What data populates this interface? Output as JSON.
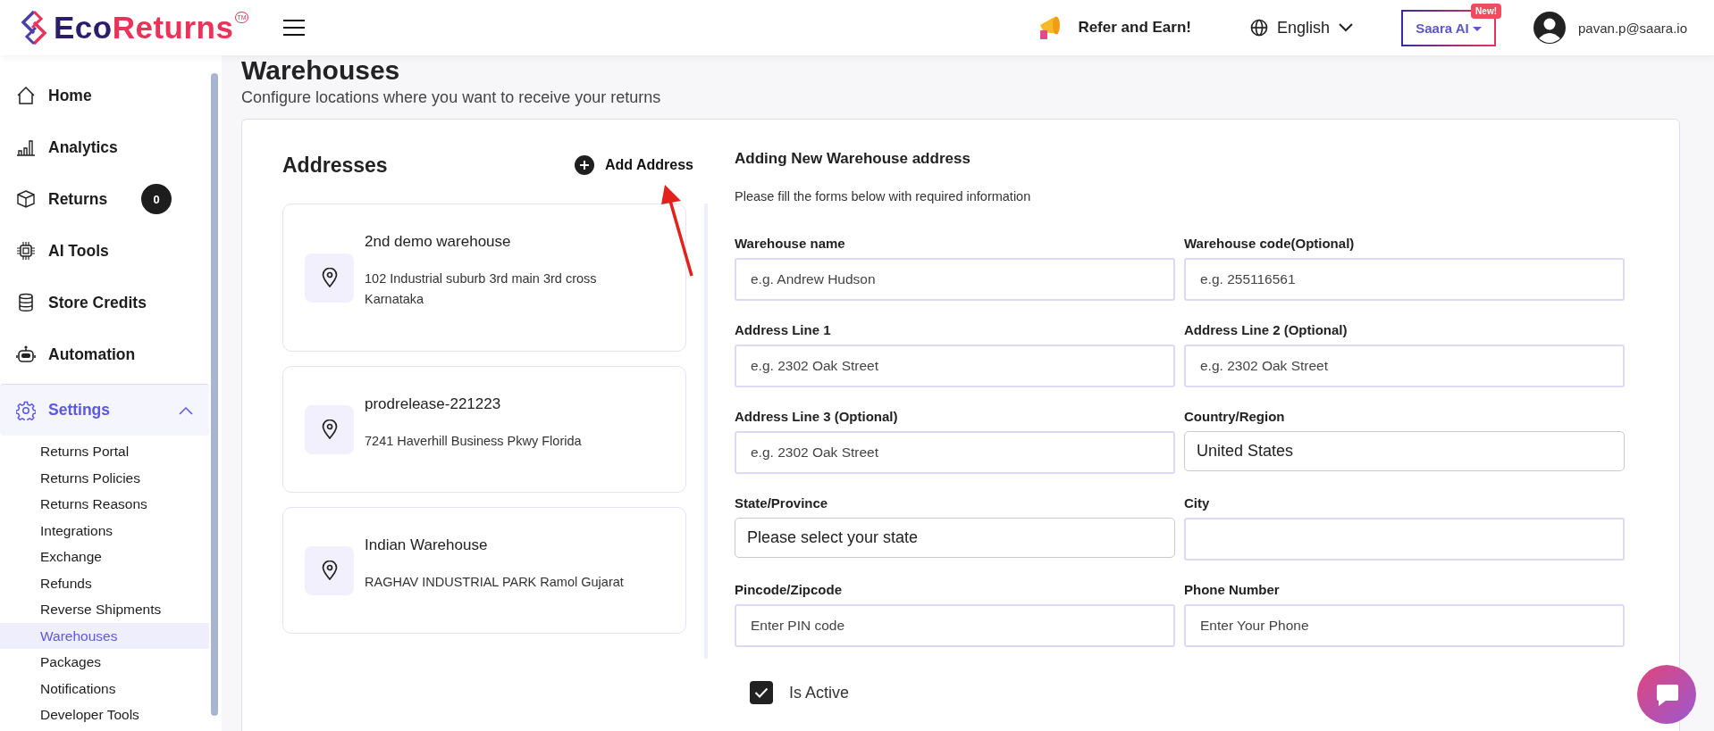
{
  "header": {
    "logo": {
      "first": "Eco",
      "second": "Returns",
      "mark": "TM"
    },
    "refer": "Refer and Earn!",
    "language": "English",
    "assistant": {
      "label": "Saara AI",
      "badge": "New!"
    },
    "user": "pavan.p@saara.io"
  },
  "sidebar": {
    "items": [
      {
        "label": "Home",
        "selected": false
      },
      {
        "label": "Analytics",
        "selected": false
      },
      {
        "label": "Returns",
        "selected": false,
        "badge": "0"
      },
      {
        "label": "AI Tools",
        "selected": false
      },
      {
        "label": "Store Credits",
        "selected": false
      },
      {
        "label": "Automation",
        "selected": false
      },
      {
        "label": "Settings",
        "selected": true,
        "expanded": true,
        "children": [
          {
            "label": "Returns Portal",
            "selected": false
          },
          {
            "label": "Returns Policies",
            "selected": false
          },
          {
            "label": "Returns Reasons",
            "selected": false
          },
          {
            "label": "Integrations",
            "selected": false
          },
          {
            "label": "Exchange",
            "selected": false
          },
          {
            "label": "Refunds",
            "selected": false
          },
          {
            "label": "Reverse Shipments",
            "selected": false
          },
          {
            "label": "Warehouses",
            "selected": true
          },
          {
            "label": "Packages",
            "selected": false
          },
          {
            "label": "Notifications",
            "selected": false
          },
          {
            "label": "Developer Tools",
            "selected": false
          }
        ]
      }
    ]
  },
  "page": {
    "title": "Warehouses",
    "subtitle": "Configure locations where you want to receive your returns"
  },
  "addresses": {
    "heading": "Addresses",
    "add_button": "Add Address",
    "cards": [
      {
        "name": "2nd demo warehouse",
        "lines": [
          "102 Industrial suburb 3rd main 3rd cross",
          "Karnataka"
        ]
      },
      {
        "name": "prodrelease-221223",
        "lines": [
          "7241 Haverhill Business Pkwy Florida"
        ]
      },
      {
        "name": "Indian Warehouse",
        "lines": [
          "RAGHAV INDUSTRIAL PARK Ramol Gujarat"
        ]
      }
    ]
  },
  "form": {
    "title": "Adding New Warehouse address",
    "hint": "Please fill the forms below with required information",
    "fields": [
      {
        "label": "Warehouse name",
        "kind": "input",
        "placeholder": "e.g. Andrew Hudson"
      },
      {
        "label": "Warehouse code(Optional)",
        "kind": "input",
        "placeholder": "e.g. 255116561"
      },
      {
        "label": "Address Line 1",
        "kind": "input",
        "placeholder": "e.g. 2302 Oak Street"
      },
      {
        "label": "Address Line 2 (Optional)",
        "kind": "input",
        "placeholder": "e.g. 2302 Oak Street"
      },
      {
        "label": "Address Line 3 (Optional)",
        "kind": "input",
        "placeholder": "e.g. 2302 Oak Street"
      },
      {
        "label": "Country/Region",
        "kind": "select",
        "value": "United States"
      },
      {
        "label": "State/Province",
        "kind": "select",
        "value": "Please select your state"
      },
      {
        "label": "City",
        "kind": "input"
      },
      {
        "label": "Pincode/Zipcode",
        "kind": "input",
        "placeholder": "Enter PIN code"
      },
      {
        "label": "Phone Number",
        "kind": "input",
        "placeholder": "Enter Your Phone"
      }
    ],
    "active": {
      "label": "Is Active",
      "checked": true
    }
  }
}
